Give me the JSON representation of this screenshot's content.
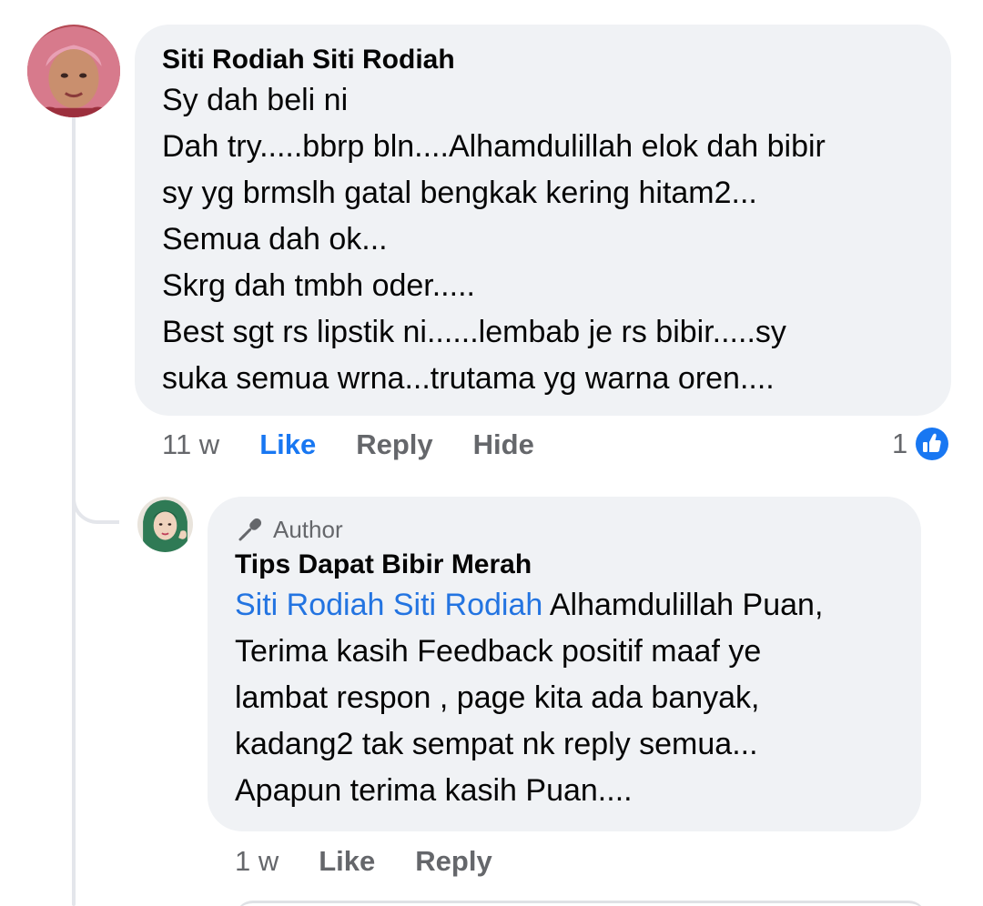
{
  "comment": {
    "author": "Siti Rodiah Siti Rodiah",
    "lines": [
      "Sy dah beli ni",
      "Dah try.....bbrp bln....Alhamdulillah elok dah bibir",
      "sy yg brmslh gatal bengkak kering hitam2...",
      "Semua dah ok...",
      "Skrg dah tmbh oder.....",
      "Best sgt rs lipstik ni......lembab je rs bibir.....sy",
      "suka semua wrna...trutama yg warna oren...."
    ],
    "timestamp": "11 w",
    "actions": {
      "like": "Like",
      "reply": "Reply",
      "hide": "Hide"
    },
    "reaction_count": "1",
    "reaction_icon": "like-thumb-icon"
  },
  "reply": {
    "badge": "Author",
    "badge_icon": "microphone-icon",
    "author": "Tips Dapat Bibir Merah",
    "mention": "Siti Rodiah Siti Rodiah",
    "first_line_rest": " Alhamdulillah Puan,",
    "lines": [
      "Terima kasih Feedback positif maaf ye",
      "lambat respon , page kita ada banyak,",
      "kadang2 tak sempat nk reply semua...",
      "Apapun terima kasih Puan...."
    ],
    "timestamp": "1 w",
    "actions": {
      "like": "Like",
      "reply": "Reply"
    }
  },
  "colors": {
    "bubble": "#f0f2f5",
    "text": "#050505",
    "secondary_text": "#65676b",
    "link_blue": "#2374e1",
    "like_blue": "#1877f2"
  }
}
